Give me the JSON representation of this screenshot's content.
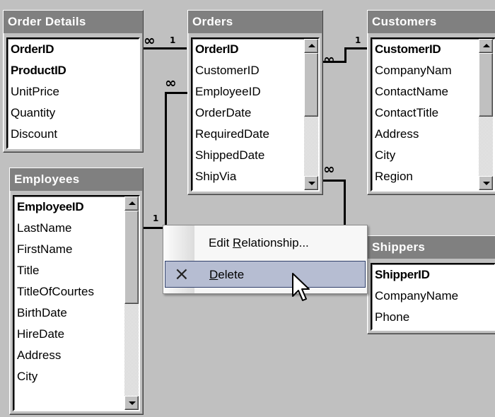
{
  "tables": {
    "order_details": {
      "title": "Order Details",
      "fields": [
        "OrderID",
        "ProductID",
        "UnitPrice",
        "Quantity",
        "Discount"
      ]
    },
    "orders": {
      "title": "Orders",
      "fields": [
        "OrderID",
        "CustomerID",
        "EmployeeID",
        "OrderDate",
        "RequiredDate",
        "ShippedDate",
        "ShipVia"
      ]
    },
    "customers": {
      "title": "Customers",
      "fields": [
        "CustomerID",
        "CompanyNam",
        "ContactName",
        "ContactTitle",
        "Address",
        "City",
        "Region"
      ]
    },
    "employees": {
      "title": "Employees",
      "fields": [
        "EmployeeID",
        "LastName",
        "FirstName",
        "Title",
        "TitleOfCourtes",
        "BirthDate",
        "HireDate",
        "Address",
        "City"
      ]
    },
    "shippers": {
      "title": "Shippers",
      "fields": [
        "ShipperID",
        "CompanyName",
        "Phone"
      ]
    }
  },
  "relationship_labels": {
    "one": "1",
    "many": "∞"
  },
  "context_menu": {
    "edit_prefix": "Edit ",
    "edit_mnemonic": "R",
    "edit_suffix": "elationship...",
    "delete_mnemonic": "D",
    "delete_suffix": "elete",
    "delete_icon": "×"
  }
}
